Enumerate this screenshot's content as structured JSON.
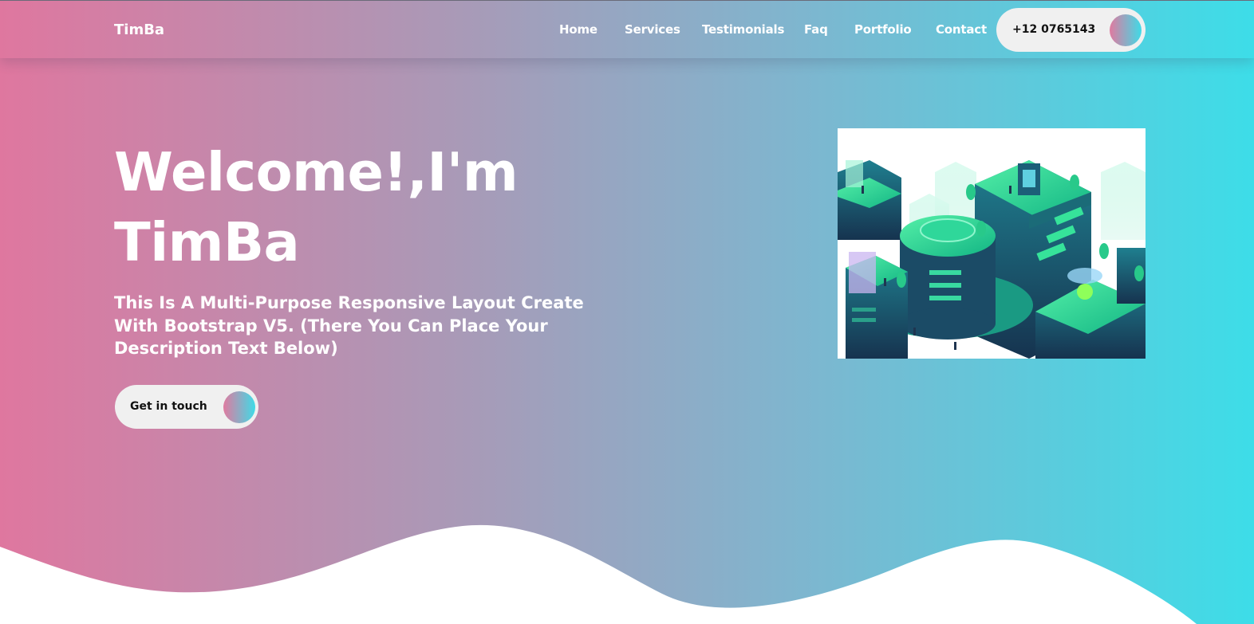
{
  "header": {
    "brand": "TimBa",
    "nav": [
      "Home",
      "Services",
      "Testimonials",
      "Faq",
      "Portfolio",
      "Contact"
    ],
    "phone": "+12 0765143"
  },
  "hero": {
    "title_line1": "Welcome!,I'm",
    "title_line2": "TimBa",
    "description": "This Is A Multi-Purpose Responsive Layout Create With Bootstrap V5. (There You Can Place Your Description Text Below)",
    "cta_label": "Get in touch"
  },
  "icons": {
    "phone_button": "gradient-circle-icon",
    "cta_button": "gradient-circle-icon",
    "illustration": "isometric-city-illustration"
  },
  "colors": {
    "gradient_start": "#df779f",
    "gradient_end": "#3ddde8",
    "pill_bg": "#f0f0f0",
    "text": "#ffffff"
  }
}
